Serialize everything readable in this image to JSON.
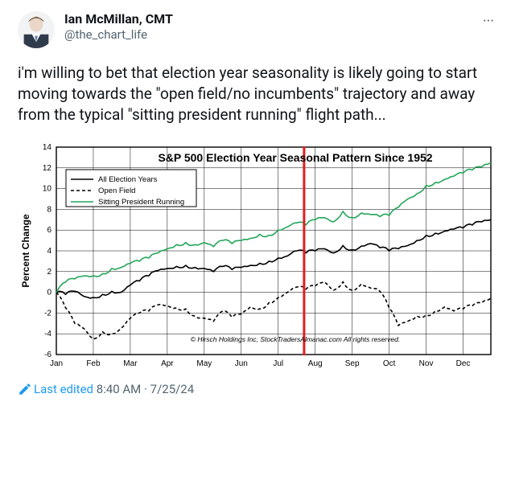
{
  "author": {
    "display_name": "Ian McMillan, CMT",
    "handle": "@the_chart_life"
  },
  "body_text": "i'm willing to bet that election year seasonality is likely going to start moving towards the \"open field/no incumbents\" trajectory and away from the typical \"sitting president running\" flight path...",
  "footer": {
    "edited_label": "Last edited",
    "time": "8:40 AM",
    "date": "7/25/24"
  },
  "chart_data": {
    "type": "line",
    "title": "S&P 500 Election Year Seasonal Pattern Since 1952",
    "ylabel": "Percent Change",
    "ylim": [
      -6,
      14
    ],
    "yticks": [
      -6,
      -4,
      -2,
      0,
      2,
      4,
      6,
      8,
      10,
      12,
      14
    ],
    "x_categories": [
      "Jan",
      "Feb",
      "Mar",
      "Apr",
      "May",
      "Jun",
      "Jul",
      "Aug",
      "Sep",
      "Oct",
      "Nov",
      "Dec"
    ],
    "marker_x": 6.7,
    "credits": "© Hirsch Holdings Inc, StockTradersAlmanac.com  All rights reserved.",
    "legend": {
      "items": [
        {
          "key": "all",
          "label": "All Election Years"
        },
        {
          "key": "open",
          "label": "Open Field"
        },
        {
          "key": "sit",
          "label": "Sitting President Running"
        }
      ]
    },
    "series": [
      {
        "name": "All Election Years",
        "key": "all",
        "color": "#000000",
        "style": "solid",
        "x": [
          0,
          0.25,
          0.5,
          0.75,
          1,
          1.25,
          1.5,
          1.75,
          2,
          2.25,
          2.5,
          2.75,
          3,
          3.25,
          3.5,
          3.75,
          4,
          4.25,
          4.5,
          4.75,
          5,
          5.25,
          5.5,
          5.75,
          6,
          6.25,
          6.5,
          6.75,
          7,
          7.25,
          7.5,
          7.75,
          8,
          8.25,
          8.5,
          8.75,
          9,
          9.25,
          9.5,
          9.75,
          10,
          10.25,
          10.5,
          10.75,
          11,
          11.25,
          11.5,
          11.75
        ],
        "y": [
          0,
          -0.2,
          0.1,
          -0.4,
          -0.5,
          -0.2,
          0.1,
          0.0,
          0.7,
          1.1,
          1.6,
          2.1,
          2.3,
          2.5,
          2.6,
          2.4,
          2.3,
          2.0,
          2.5,
          2.2,
          2.4,
          2.6,
          2.8,
          3.0,
          3.3,
          3.5,
          4.0,
          3.8,
          4.0,
          4.2,
          3.8,
          4.5,
          4.1,
          4.46,
          4.7,
          4.3,
          4.0,
          4.2,
          4.5,
          5.0,
          5.5,
          5.7,
          5.9,
          6.1,
          6.2,
          6.5,
          6.8,
          7.0
        ]
      },
      {
        "name": "Open Field",
        "key": "open",
        "color": "#000000",
        "style": "dashed",
        "x": [
          0,
          0.25,
          0.5,
          0.75,
          1,
          1.25,
          1.5,
          1.75,
          2,
          2.25,
          2.5,
          2.75,
          3,
          3.25,
          3.5,
          3.75,
          4,
          4.25,
          4.5,
          4.75,
          5,
          5.25,
          5.5,
          5.75,
          6,
          6.25,
          6.5,
          6.75,
          7,
          7.25,
          7.5,
          7.75,
          8,
          8.25,
          8.5,
          8.75,
          9,
          9.25,
          9.5,
          9.75,
          10,
          10.25,
          10.5,
          10.75,
          11,
          11.25,
          11.5,
          11.75
        ],
        "y": [
          0,
          -1.5,
          -3.0,
          -3.5,
          -4.5,
          -3.8,
          -4.0,
          -3.5,
          -2.5,
          -2.0,
          -1.8,
          -1.2,
          -1.3,
          -1.5,
          -1.6,
          -2.3,
          -2.5,
          -2.8,
          -1.8,
          -2.4,
          -2.1,
          -1.4,
          -1.6,
          -1.0,
          -0.5,
          0.0,
          0.5,
          0.3,
          0.6,
          1.0,
          0.2,
          1.0,
          0.2,
          0.8,
          0.4,
          0.1,
          -1.5,
          -3.2,
          -2.8,
          -2.3,
          -2.2,
          -1.8,
          -1.4,
          -1.8,
          -1.6,
          -1.3,
          -1.0,
          -0.6
        ]
      },
      {
        "name": "Sitting President Running",
        "key": "sit",
        "color": "#24a65a",
        "style": "solid",
        "x": [
          0,
          0.25,
          0.5,
          0.75,
          1,
          1.25,
          1.5,
          1.75,
          2,
          2.25,
          2.5,
          2.75,
          3,
          3.25,
          3.5,
          3.75,
          4,
          4.25,
          4.5,
          4.75,
          5,
          5.25,
          5.5,
          5.75,
          6,
          6.25,
          6.5,
          6.75,
          7,
          7.25,
          7.5,
          7.75,
          8,
          8.25,
          8.5,
          8.75,
          9,
          9.25,
          9.5,
          9.75,
          10,
          10.25,
          10.5,
          10.75,
          11,
          11.25,
          11.5,
          11.75
        ],
        "y": [
          0,
          1.0,
          1.3,
          1.6,
          1.6,
          1.8,
          2.3,
          2.4,
          2.8,
          3.0,
          3.3,
          3.8,
          4.2,
          4.6,
          4.8,
          4.6,
          4.8,
          4.4,
          5.0,
          4.7,
          5.0,
          5.2,
          5.6,
          5.5,
          6.0,
          6.3,
          6.7,
          6.5,
          7.0,
          7.2,
          6.8,
          7.8,
          7.2,
          7.65,
          7.5,
          7.3,
          7.4,
          8.2,
          9.0,
          9.5,
          10.3,
          10.6,
          10.9,
          11.2,
          11.5,
          11.8,
          12.1,
          12.5
        ]
      }
    ]
  }
}
